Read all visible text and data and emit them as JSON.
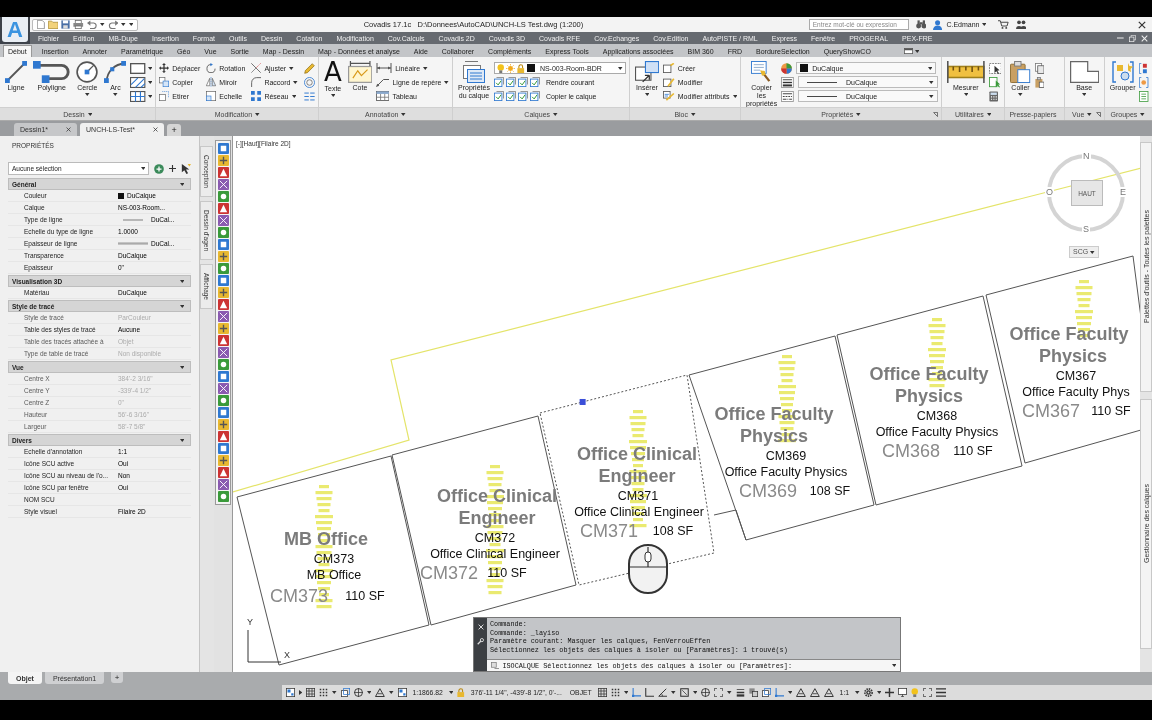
{
  "title_bar": {
    "logo": "A",
    "title": "Covadis 17.1c   D:\\Donnees\\AutoCAD\\UNCH-LS Test.dwg (1:200)",
    "search": {
      "placeholder": "Entrez mot-clé ou expression"
    },
    "user": "C.Edmann"
  },
  "menu_bar": [
    "Fichier",
    "Edition",
    "MB-Dupe",
    "Insertion",
    "Format",
    "Outils",
    "Dessin",
    "Cotation",
    "Modification",
    "Cov.Calculs",
    "Covadis 2D",
    "Covadis 3D",
    "Covadis RFE",
    "Cov.Echanges",
    "Cov.Edition",
    "AutoPISTE / RML",
    "Express",
    "Fenêtre",
    "PROGERAL",
    "PEX-FRE"
  ],
  "ribbon_tabs": [
    {
      "label": "Début",
      "selected": true
    },
    {
      "label": "Insertion",
      "selected": false
    },
    {
      "label": "Annoter",
      "selected": false
    },
    {
      "label": "Paramétrique",
      "selected": false
    },
    {
      "label": "Géo",
      "selected": false
    },
    {
      "label": "Vue",
      "selected": false
    },
    {
      "label": "Sortie",
      "selected": false
    },
    {
      "label": "Map - Dessin",
      "selected": false
    },
    {
      "label": "Map - Données et analyse",
      "selected": false
    },
    {
      "label": "Aide",
      "selected": false
    },
    {
      "label": "Collaborer",
      "selected": false
    },
    {
      "label": "Compléments",
      "selected": false
    },
    {
      "label": "Express Tools",
      "selected": false
    },
    {
      "label": "Applications associées",
      "selected": false
    },
    {
      "label": "BIM 360",
      "selected": false
    },
    {
      "label": "FRD",
      "selected": false
    },
    {
      "label": "BordureSelection",
      "selected": false
    },
    {
      "label": "QueryShowCO",
      "selected": false
    }
  ],
  "ribbon_panels": [
    {
      "title": "Dessin",
      "menu": true,
      "launcher": false,
      "tools": [
        {
          "kind": "large",
          "label": "Ligne",
          "dropdown": false
        },
        {
          "kind": "large",
          "label": "Polyligne",
          "dropdown": false
        },
        {
          "kind": "large",
          "label": "Cercle",
          "dropdown": true
        },
        {
          "kind": "large",
          "label": "Arc",
          "dropdown": true
        },
        {
          "kind": "icon",
          "dropdown": true
        },
        {
          "kind": "icon",
          "dropdown": true
        },
        {
          "kind": "icon",
          "dropdown": true
        }
      ]
    },
    {
      "title": "Modification",
      "menu": true,
      "launcher": false,
      "tools": [
        {
          "kind": "small",
          "label": "Déplacer",
          "dropdown": false
        },
        {
          "kind": "small",
          "label": "Copier",
          "dropdown": false
        },
        {
          "kind": "small",
          "label": "Etirer",
          "dropdown": false
        },
        {
          "kind": "small",
          "label": "Rotation",
          "dropdown": false
        },
        {
          "kind": "small",
          "label": "Miroir",
          "dropdown": false
        },
        {
          "kind": "small",
          "label": "Echelle",
          "dropdown": false
        },
        {
          "kind": "small",
          "label": "Ajuster",
          "dropdown": true
        },
        {
          "kind": "small",
          "label": "Raccord",
          "dropdown": true
        },
        {
          "kind": "small",
          "label": "Réseau",
          "dropdown": true
        },
        {
          "kind": "icon",
          "dropdown": false
        },
        {
          "kind": "icon",
          "dropdown": false
        },
        {
          "kind": "icon",
          "dropdown": false
        }
      ]
    },
    {
      "title": "Annotation",
      "menu": true,
      "launcher": false,
      "tools": [
        {
          "kind": "large",
          "label": "Texte",
          "glyph": "A",
          "dropdown": true
        },
        {
          "kind": "large",
          "label": "Cote",
          "dropdown": false
        },
        {
          "kind": "small",
          "label": "Linéaire",
          "dropdown": true
        },
        {
          "kind": "small",
          "label": "Ligne de repère",
          "dropdown": true
        },
        {
          "kind": "small",
          "label": "Tableau",
          "dropdown": false
        }
      ]
    },
    {
      "title": "Calques",
      "menu": true,
      "launcher": false,
      "tools": [
        {
          "kind": "large",
          "label": "Propriétés du calque",
          "dropdown": false
        },
        {
          "kind": "layer",
          "label": "NS-003-Room-BDR",
          "dropdown": true
        },
        {
          "kind": "cluster",
          "label": "Rendre courant",
          "dropdown": false
        },
        {
          "kind": "cluster",
          "label": "Copier le calque",
          "dropdown": false
        }
      ]
    },
    {
      "title": "Bloc",
      "menu": true,
      "launcher": false,
      "tools": [
        {
          "kind": "large",
          "label": "Insérer",
          "dropdown": true
        },
        {
          "kind": "small",
          "label": "Créer",
          "dropdown": false
        },
        {
          "kind": "small",
          "label": "Modifier",
          "dropdown": false
        },
        {
          "kind": "small",
          "label": "Modifier attributs",
          "dropdown": true
        }
      ]
    },
    {
      "title": "Propriétés",
      "menu": true,
      "launcher": true,
      "tools": [
        {
          "kind": "large",
          "label": "Copier les propriétés",
          "dropdown": false
        },
        {
          "kind": "color",
          "label": "DuCalque",
          "dropdown": true
        },
        {
          "kind": "lineweight",
          "label": "DuCalque",
          "dropdown": true
        },
        {
          "kind": "linetype",
          "label": "DuCalque",
          "dropdown": true
        }
      ]
    },
    {
      "title": "Utilitaires",
      "menu": true,
      "launcher": false,
      "tools": [
        {
          "kind": "large",
          "label": "Mesurer",
          "dropdown": true
        },
        {
          "kind": "icon",
          "dropdown": false
        },
        {
          "kind": "icon",
          "dropdown": false
        },
        {
          "kind": "icon",
          "dropdown": false
        }
      ]
    },
    {
      "title": "Presse-papiers",
      "menu": false,
      "launcher": false,
      "tools": [
        {
          "kind": "large",
          "label": "Coller",
          "dropdown": true
        },
        {
          "kind": "icon",
          "dropdown": false
        },
        {
          "kind": "icon",
          "dropdown": false
        }
      ]
    },
    {
      "title": "Vue",
      "menu": true,
      "launcher": true,
      "tools": [
        {
          "kind": "large",
          "label": "Base",
          "dropdown": true
        }
      ]
    },
    {
      "title": "Groupes",
      "menu": true,
      "launcher": false,
      "tools": [
        {
          "kind": "large",
          "label": "Grouper",
          "dropdown": false
        },
        {
          "kind": "icon",
          "dropdown": false
        },
        {
          "kind": "icon",
          "dropdown": false
        },
        {
          "kind": "icon",
          "dropdown": false
        }
      ]
    }
  ],
  "file_tabs": {
    "tabs": [
      {
        "label": "Dessin1*",
        "selected": false
      },
      {
        "label": "UNCH-LS-Test*",
        "selected": true
      }
    ],
    "new_tab": "+"
  },
  "properties": {
    "title": "PROPRIÉTÉS",
    "selection": "Aucune sélection",
    "sections": [
      {
        "title": "Général",
        "expanded": true,
        "rows": [
          {
            "label": "Couleur",
            "value": "DuCalque",
            "kind": "color",
            "disabled": false
          },
          {
            "label": "Calque",
            "value": "NS-003-Room...",
            "kind": "text",
            "disabled": false
          },
          {
            "label": "Type de ligne",
            "value": "DuCal...",
            "kind": "linetype",
            "disabled": false
          },
          {
            "label": "Echelle du type de ligne",
            "value": "1.0000",
            "kind": "text",
            "disabled": false
          },
          {
            "label": "Epaisseur de ligne",
            "value": "DuCal...",
            "kind": "lineweight",
            "disabled": false
          },
          {
            "label": "Transparence",
            "value": "DuCalque",
            "kind": "text",
            "disabled": false
          },
          {
            "label": "Epaisseur",
            "value": "0\"",
            "kind": "text",
            "disabled": false
          }
        ]
      },
      {
        "title": "Visualisation 3D",
        "expanded": true,
        "rows": [
          {
            "label": "Matériau",
            "value": "DuCalque",
            "kind": "text",
            "disabled": false
          }
        ]
      },
      {
        "title": "Style de tracé",
        "expanded": true,
        "rows": [
          {
            "label": "Style de tracé",
            "value": "ParCouleur",
            "kind": "text",
            "disabled": true
          },
          {
            "label": "Table des styles de tracé",
            "value": "Aucune",
            "kind": "text",
            "disabled": false
          },
          {
            "label": "Table des tracés attachée à",
            "value": "Objet",
            "kind": "text",
            "disabled": true
          },
          {
            "label": "Type de table de tracé",
            "value": "Non disponible",
            "kind": "text",
            "disabled": true
          }
        ]
      },
      {
        "title": "Vue",
        "expanded": true,
        "rows": [
          {
            "label": "Centre X",
            "value": "384'-2 3/16\"",
            "kind": "text",
            "disabled": true
          },
          {
            "label": "Centre Y",
            "value": "-339'-4 1/2\"",
            "kind": "text",
            "disabled": true
          },
          {
            "label": "Centre Z",
            "value": "0\"",
            "kind": "text",
            "disabled": true
          },
          {
            "label": "Hauteur",
            "value": "56'-6 3/16\"",
            "kind": "text",
            "disabled": true
          },
          {
            "label": "Largeur",
            "value": "58'-7 5/8\"",
            "kind": "text",
            "disabled": true
          }
        ]
      },
      {
        "title": "Divers",
        "expanded": true,
        "rows": [
          {
            "label": "Echelle d'annotation",
            "value": "1:1",
            "kind": "text",
            "disabled": false
          },
          {
            "label": "Icône SCU active",
            "value": "Oui",
            "kind": "text",
            "disabled": false
          },
          {
            "label": "Icône SCU au niveau de l'o...",
            "value": "Non",
            "kind": "text",
            "disabled": false
          },
          {
            "label": "Icône SCU par fenêtre",
            "value": "Oui",
            "kind": "text",
            "disabled": false
          },
          {
            "label": "NOM SCU",
            "kind": "text",
            "disabled": false
          },
          {
            "label": "Style visuel",
            "value": "Filaire 2D",
            "kind": "text",
            "disabled": false
          }
        ]
      }
    ]
  },
  "side_tabs": [
    "Conception",
    "Dessin d'agen",
    "Affichage"
  ],
  "drawing": {
    "viewport_label": "[-][Haut][Filaire 2D]",
    "viewcube": {
      "top": "HAUT",
      "north": "N",
      "south": "S",
      "east": "E",
      "west": "O",
      "coordinate_system": "SCG"
    },
    "rooms": [
      {
        "name_lines": [
          "MB Office"
        ],
        "number": "CM373",
        "label": "MB Office",
        "area": "110 SF",
        "tag": "CM373",
        "selected": false
      },
      {
        "name_lines": [
          "Office Clinical",
          "Engineer"
        ],
        "number": "CM372",
        "label": "Office Clinical Engineer",
        "area": "110 SF",
        "tag": "CM372",
        "selected": false
      },
      {
        "name_lines": [
          "Office Clinical",
          "Engineer"
        ],
        "number": "CM371",
        "label": "Office Clinical Engineer",
        "area": "108 SF",
        "tag": "CM371",
        "selected": true
      },
      {
        "name_lines": [
          "Office Faculty",
          "Physics"
        ],
        "number": "CM369",
        "label": "Office Faculty Physics",
        "area": "108 SF",
        "tag": "CM369",
        "selected": false
      },
      {
        "name_lines": [
          "Office Faculty",
          "Physics"
        ],
        "number": "CM368",
        "label": "Office Faculty Physics",
        "area": "110 SF",
        "tag": "CM368",
        "selected": false
      },
      {
        "name_lines": [
          "Office Faculty",
          "Physics"
        ],
        "number": "CM367",
        "label": "Office Faculty Phys",
        "area": "110 SF",
        "tag": "CM367",
        "selected": false
      }
    ],
    "ucs": {
      "y": "Y",
      "x": "X"
    }
  },
  "right_tabs": [
    "Palettes d'outils - Toutes les palettes",
    "Gestionnaire des calques"
  ],
  "command_line": {
    "history": [
      "Commande:",
      "Commande: _layiso",
      "Paramètre courant: Masquer les calques, FenVerrouEffen",
      "Sélectionnez les objets des calques à isoler ou [Paramètres]: 1 trouvé(s)"
    ],
    "prompt": "ISOCALQUE Sélectionnez les objets des calques à isoler ou [Paramètres]:"
  },
  "layout_tabs": {
    "tabs": [
      {
        "label": "Objet",
        "selected": true
      },
      {
        "label": "Présentation1",
        "selected": false
      }
    ],
    "new_tab": "+"
  },
  "status_bar": {
    "scale": "1:1866.82",
    "coordinates": "376'-11 1/4\", -439'-8 1/2\", 0'-...",
    "space": "OBJET",
    "annotation_scale": "1:1"
  }
}
